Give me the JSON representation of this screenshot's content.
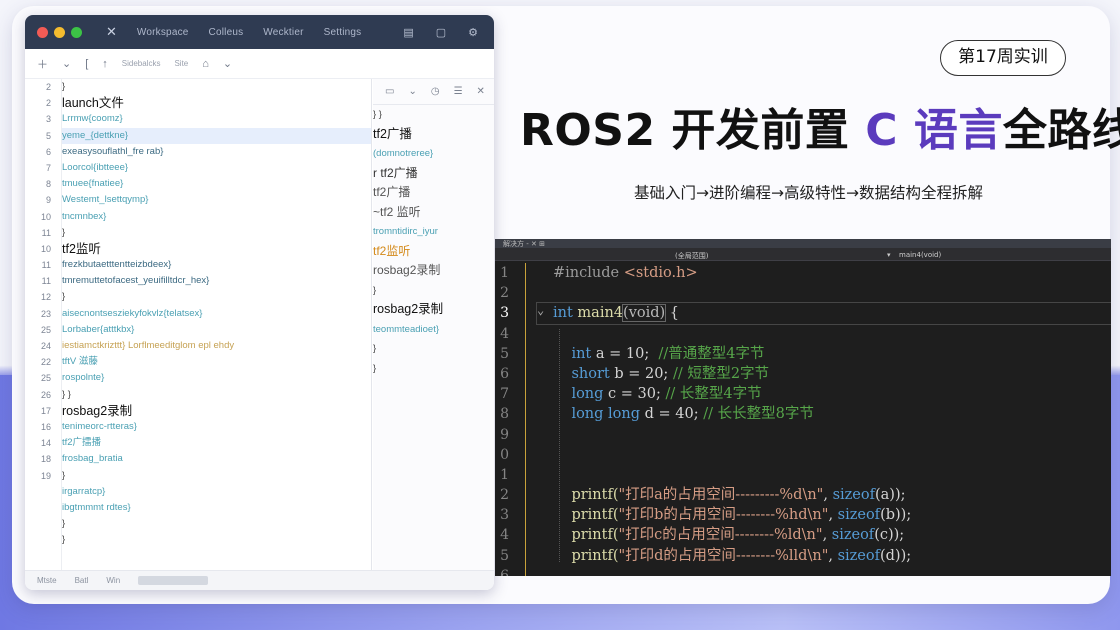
{
  "badge": "第17周实训",
  "title": {
    "part1": "ROS2 开发前置 ",
    "accent": "C 语言",
    "part2": "全路线"
  },
  "subtitle": "基础入门→进阶编程→高级特性→数据结构全程拆解",
  "colors": {
    "accent": "#5b3bbd",
    "editor_bg": "#1e1e1e",
    "keyword": "#569cd6",
    "string": "#d69d85",
    "comment": "#57a64a"
  },
  "ide": {
    "window_controls": [
      "close-dot",
      "minimize-dot",
      "maximize-dot"
    ],
    "menu": [
      "Workspace",
      "Colleus",
      "Wecktier",
      "Settings"
    ],
    "toolbar_label": "Sidebalcks",
    "toolbar_label2": "Site",
    "gutter": [
      "2",
      "2",
      "3",
      "5",
      "6",
      "7",
      "8",
      "9",
      "10",
      "11",
      "10",
      "11",
      "11",
      "12",
      "23",
      "25",
      "24",
      "22",
      "25",
      "26",
      "17",
      "16",
      "14",
      "18",
      "19"
    ],
    "tree": [
      {
        "t": "}",
        "c": "brace"
      },
      {
        "t": "launch文件",
        "c": "head"
      },
      {
        "t": "  Lrrmw{coomz}",
        "c": ""
      },
      {
        "t": "  yeme_{dettkne}",
        "c": "hl"
      },
      {
        "t": "  exeasysouflathl_fre rab}",
        "c": "dark"
      },
      {
        "t": "      Loorcol{ibtteee}",
        "c": ""
      },
      {
        "t": "      tmuee{fnatiee}",
        "c": ""
      },
      {
        "t": "      Westemt_lsettqymp}",
        "c": ""
      },
      {
        "t": "      tncmnbex}",
        "c": ""
      },
      {
        "t": "    }",
        "c": "brace"
      },
      {
        "t": "      tf2监听",
        "c": "head"
      },
      {
        "t": "          frezkbutaetttentteizbdeex}",
        "c": "dark"
      },
      {
        "t": "          tmremuttetofacest_yeuifilltdcr_hex}",
        "c": "dark"
      },
      {
        "t": "    }",
        "c": "brace"
      },
      {
        "t": "  aisecnontsesziekyfokvlz{telatsex}",
        "c": ""
      },
      {
        "t": "      Lorbaber{atttkbx}",
        "c": ""
      },
      {
        "t": "      iestiamctkrizttt}  Lorflmeeditglom epl ehdy",
        "c": "mix"
      },
      {
        "t": "      tftV 滋藤",
        "c": ""
      },
      {
        "t": "      rospolnte}",
        "c": ""
      },
      {
        "t": "} }",
        "c": "brace"
      },
      {
        "t": "  rosbag2录制",
        "c": "head"
      },
      {
        "t": "      tenimeorc-rtteras}",
        "c": ""
      },
      {
        "t": "      tf2广擂播",
        "c": ""
      },
      {
        "t": "          frosbag_bratia",
        "c": ""
      },
      {
        "t": "    }",
        "c": "brace"
      },
      {
        "t": "      irgarratcp}",
        "c": ""
      },
      {
        "t": "      ibgtmmmt  rdtes}",
        "c": ""
      },
      {
        "t": "    }",
        "c": "brace"
      },
      {
        "t": "}",
        "c": "brace"
      }
    ],
    "panel": [
      {
        "t": "  }  }",
        "c": "brace"
      },
      {
        "t": "    tf2广播",
        "c": "head"
      },
      {
        "t": "        (domnotreree}",
        "c": ""
      },
      {
        "t": "  r tf2广播",
        "c": "head2"
      },
      {
        "t": "      tf2广播",
        "c": "gray"
      },
      {
        "t": "      ~tf2 监听",
        "c": "gray"
      },
      {
        "t": "      tromntidirc_iyur",
        "c": ""
      },
      {
        "t": "      tf2监听",
        "c": "orange"
      },
      {
        "t": "      rosbag2录制",
        "c": "gray"
      },
      {
        "t": "    }",
        "c": "brace"
      },
      {
        "t": "    rosbag2录制",
        "c": "head"
      },
      {
        "t": "      teommteadioet}",
        "c": ""
      },
      {
        "t": "    }",
        "c": "brace"
      },
      {
        "t": "  }",
        "c": "brace"
      }
    ],
    "status": [
      "Mtste",
      "Batl",
      "Win"
    ]
  },
  "editor": {
    "top_label": "解决方 - ✕ ⊞",
    "scope": "(全局范围)",
    "function": "main4(void)",
    "line_numbers": [
      "1",
      "2",
      "3",
      "4",
      "5",
      "6",
      "7",
      "8",
      "9",
      "0",
      "1",
      "2",
      "3",
      "4",
      "5",
      "6"
    ],
    "lines": {
      "l1_a": "#include ",
      "l1_b": "<stdio.h>",
      "l3_a": "int",
      "l3_b": " main4",
      "l3_c": "(void)",
      "l3_d": " {",
      "l5_a": "int",
      "l5_b": " a = 10;  ",
      "l5_c": "//普通整型4字节",
      "l6_a": "short",
      "l6_b": " b = 20; ",
      "l6_c": "// 短整型2字节",
      "l7_a": "long",
      "l7_b": " c = 30; ",
      "l7_c": "// 长整型4字节",
      "l8_a": "long long",
      "l8_b": " d = 40; ",
      "l8_c": "// 长长整型8字节",
      "p1_a": "printf(",
      "p1_b": "\"打印a的占用空间---------%d\\n\"",
      "p1_c": ", ",
      "p1_d": "sizeof",
      "p1_e": "(a));",
      "p2_a": "printf(",
      "p2_b": "\"打印b的占用空间--------%hd\\n\"",
      "p2_c": ", ",
      "p2_d": "sizeof",
      "p2_e": "(b));",
      "p3_a": "printf(",
      "p3_b": "\"打印c的占用空间--------%ld\\n\"",
      "p3_c": ", ",
      "p3_d": "sizeof",
      "p3_e": "(c));",
      "p4_a": "printf(",
      "p4_b": "\"打印d的占用空间--------%lld\\n\"",
      "p4_c": ", ",
      "p4_d": "sizeof",
      "p4_e": "(d));"
    }
  }
}
